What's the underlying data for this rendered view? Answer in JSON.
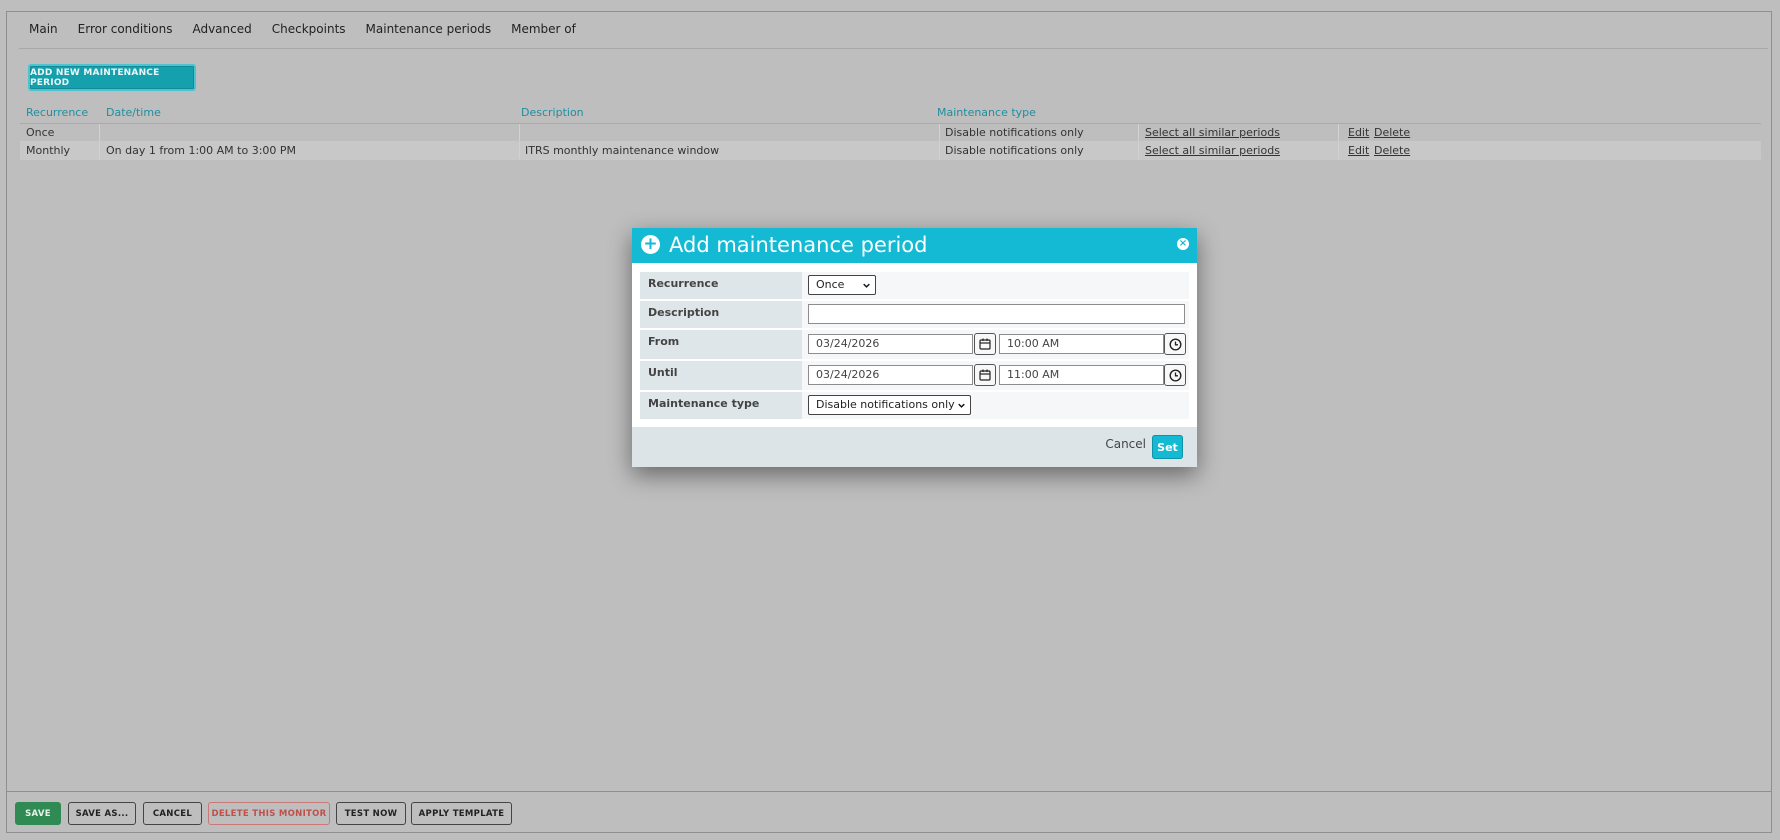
{
  "tabs": [
    "Main",
    "Error conditions",
    "Advanced",
    "Checkpoints",
    "Maintenance periods",
    "Member of"
  ],
  "active_tab": "Maintenance periods",
  "add_button": "ADD NEW MAINTENANCE PERIOD",
  "table": {
    "headers": {
      "recurrence": "Recurrence",
      "datetime": "Date/time",
      "description": "Description",
      "type": "Maintenance type"
    },
    "rows": [
      {
        "recurrence": "Once",
        "datetime": "",
        "description": "",
        "type": "Disable notifications only",
        "select_link": "Select all similar periods",
        "edit": "Edit",
        "delete": "Delete"
      },
      {
        "recurrence": "Monthly",
        "datetime": "On day 1 from 1:00 AM to 3:00 PM",
        "description": "ITRS monthly maintenance window",
        "type": "Disable notifications only",
        "select_link": "Select all similar periods",
        "edit": "Edit",
        "delete": "Delete"
      }
    ]
  },
  "modal": {
    "title": "Add maintenance period",
    "labels": {
      "recurrence": "Recurrence",
      "description": "Description",
      "from": "From",
      "until": "Until",
      "type": "Maintenance type"
    },
    "recurrence_value": "Once",
    "description_value": "",
    "from_date": "03/24/2026",
    "from_time": "10:00 AM",
    "until_date": "03/24/2026",
    "until_time": "11:00 AM",
    "type_value": "Disable notifications only",
    "cancel": "Cancel",
    "set": "Set"
  },
  "footer": {
    "save": "SAVE",
    "save_as": "SAVE AS...",
    "cancel": "CANCEL",
    "delete": "DELETE THIS MONITOR",
    "test": "TEST NOW",
    "apply": "APPLY TEMPLATE"
  },
  "colors": {
    "accent": "#14bad3",
    "header_text": "#1f8fa0",
    "save_green": "#2f8a54",
    "danger": "#c0504a"
  }
}
